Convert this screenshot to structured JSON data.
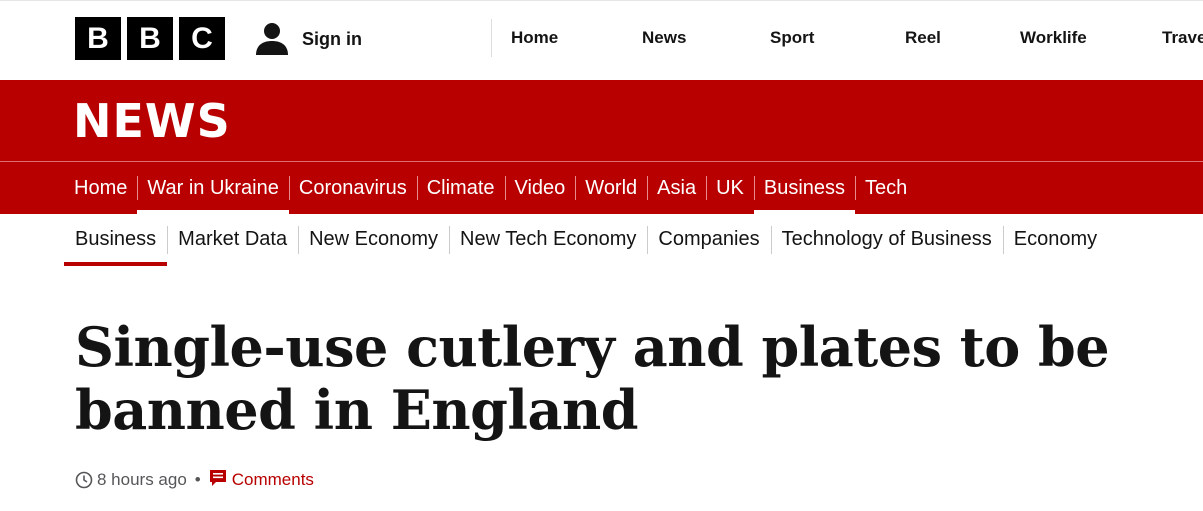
{
  "brand": {
    "letters": [
      "B",
      "B",
      "C"
    ]
  },
  "account": {
    "signin_label": "Sign in",
    "icon": "user-icon"
  },
  "global_nav": [
    "Home",
    "News",
    "Sport",
    "Reel",
    "Worklife",
    "Travel"
  ],
  "news_title": "NEWS",
  "section_nav": {
    "items": [
      "Home",
      "War in Ukraine",
      "Coronavirus",
      "Climate",
      "Video",
      "World",
      "Asia",
      "UK",
      "Business",
      "Tech"
    ],
    "active": [
      "War in Ukraine",
      "Business"
    ]
  },
  "sub_nav": {
    "items": [
      "Business",
      "Market Data",
      "New Economy",
      "New Tech Economy",
      "Companies",
      "Technology of Business",
      "Economy"
    ],
    "active": "Business"
  },
  "article": {
    "headline": "Single-use cutlery and plates to be banned in England",
    "timestamp": "8 hours ago",
    "separator": "•",
    "comments_label": "Comments"
  },
  "colors": {
    "brand_red": "#b80000",
    "text": "#141414",
    "meta_grey": "#545658"
  }
}
